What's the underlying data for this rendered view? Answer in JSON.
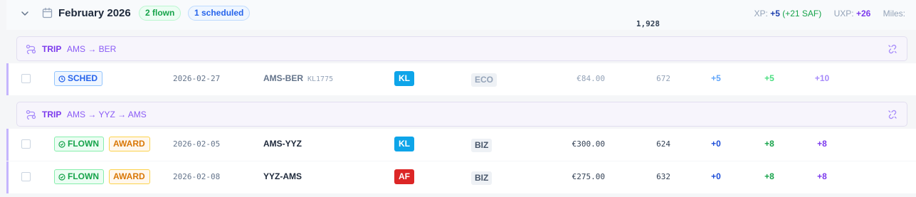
{
  "month": {
    "title": "February 2026",
    "flown_pill": "2 flown",
    "scheduled_pill": "1 scheduled",
    "stats": {
      "xp_label": "XP:",
      "xp_value": "+5",
      "xp_saf": "(+21 SAF)",
      "uxp_label": "UXP:",
      "uxp_value": "+26",
      "miles_label": "Miles:",
      "miles_value": "1,928"
    }
  },
  "trips": [
    {
      "label": "TRIP",
      "route": "AMS → BER",
      "flights": [
        {
          "status": "SCHED",
          "award": "",
          "date": "2026-02-27",
          "route": "AMS-BER",
          "flight_no": "KL1775",
          "airline": "KL",
          "airline_color": "#0ea5e9",
          "cabin": "ECO",
          "price": "€84.00",
          "miles": "672",
          "xp": "+5",
          "saf_xp": "+5",
          "uxp": "+10"
        }
      ]
    },
    {
      "label": "TRIP",
      "route": "AMS → YYZ → AMS",
      "flights": [
        {
          "status": "FLOWN",
          "award": "AWARD",
          "date": "2026-02-05",
          "route": "AMS-YYZ",
          "flight_no": "",
          "airline": "KL",
          "airline_color": "#0ea5e9",
          "cabin": "BIZ",
          "price": "€300.00",
          "miles": "624",
          "xp": "+0",
          "saf_xp": "+8",
          "uxp": "+8"
        },
        {
          "status": "FLOWN",
          "award": "AWARD",
          "date": "2026-02-08",
          "route": "YYZ-AMS",
          "flight_no": "",
          "airline": "AF",
          "airline_color": "#dc2626",
          "cabin": "BIZ",
          "price": "€275.00",
          "miles": "632",
          "xp": "+0",
          "saf_xp": "+8",
          "uxp": "+8"
        }
      ]
    }
  ]
}
